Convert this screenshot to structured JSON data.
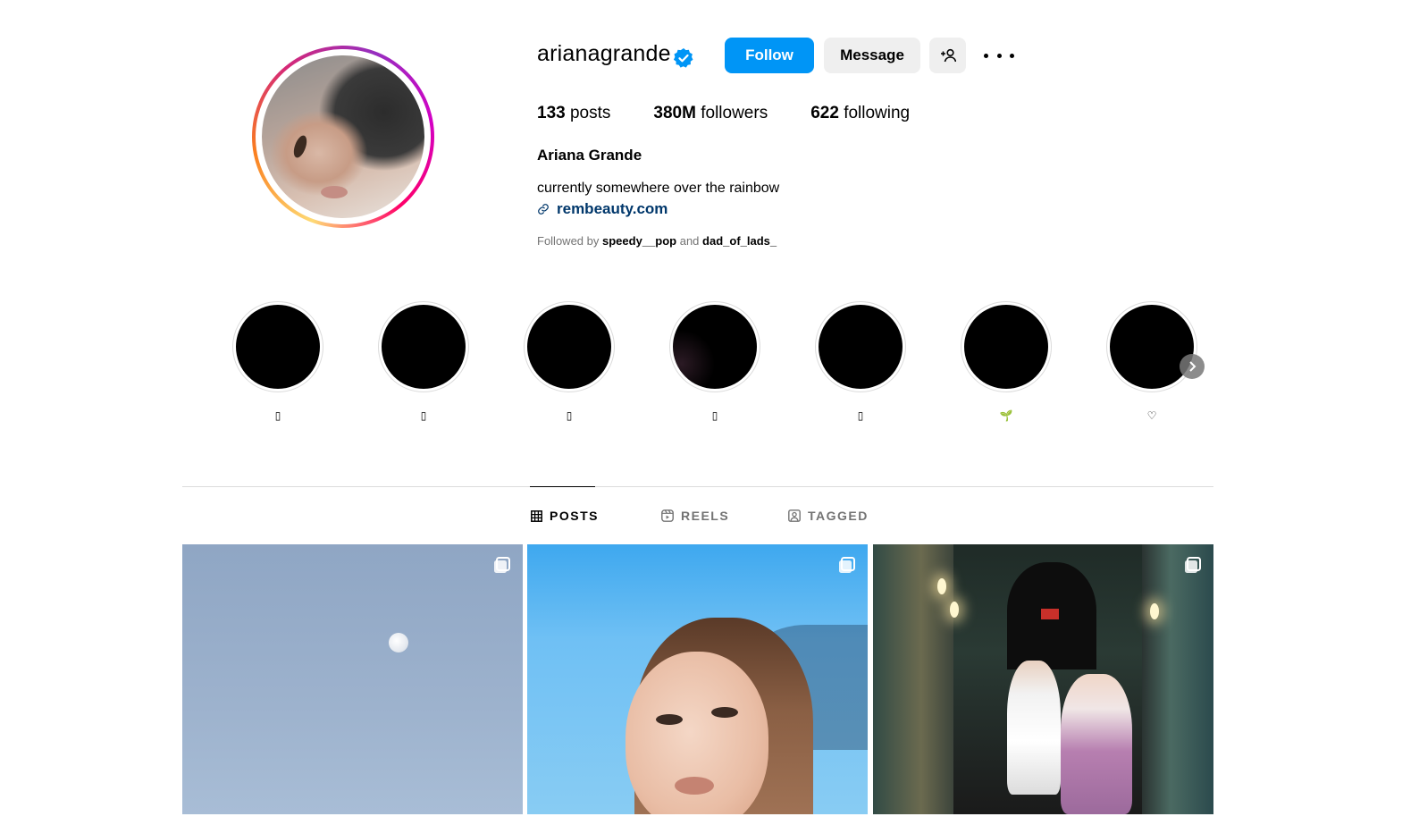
{
  "profile": {
    "username": "arianagrande",
    "full_name": "Ariana Grande",
    "bio": "currently somewhere over the rainbow",
    "link": "rembeauty.com",
    "verified": true,
    "stats": {
      "posts_count": "133",
      "posts_label": "posts",
      "followers_count": "380M",
      "followers_label": "followers",
      "following_count": "622",
      "following_label": "following"
    },
    "followed_by": {
      "prefix": "Followed by",
      "user1": "speedy__pop",
      "conjunction": "and",
      "user2": "dad_of_lads_"
    }
  },
  "actions": {
    "follow": "Follow",
    "message": "Message",
    "add_user_icon": "add-user-icon",
    "more_icon": "more-options-icon"
  },
  "highlights": [
    {
      "label": "▯"
    },
    {
      "label": "▯"
    },
    {
      "label": "▯"
    },
    {
      "label": "▯"
    },
    {
      "label": "▯"
    },
    {
      "label": "🌱"
    },
    {
      "label": "♡"
    }
  ],
  "tabs": {
    "posts": "POSTS",
    "reels": "REELS",
    "tagged": "TAGGED",
    "active": "posts"
  },
  "colors": {
    "primary": "#0095f6",
    "secondary_button": "#efefef",
    "link": "#00376b",
    "muted_text": "#737373",
    "divider": "#dbdbdb"
  }
}
